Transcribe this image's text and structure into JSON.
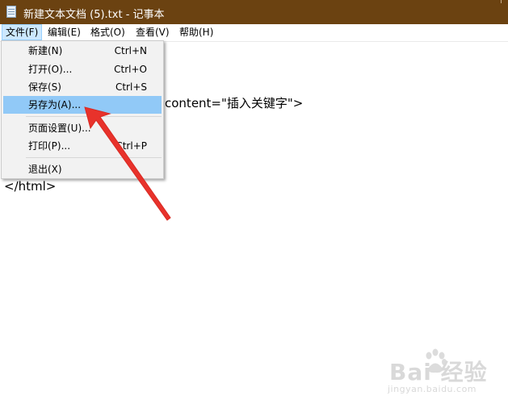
{
  "window": {
    "title": "新建文本文档 (5).txt - 记事本"
  },
  "menubar": {
    "items": [
      {
        "label": "文件(F)"
      },
      {
        "label": "编辑(E)"
      },
      {
        "label": "格式(O)"
      },
      {
        "label": "查看(V)"
      },
      {
        "label": "帮助(H)"
      }
    ],
    "active_index": 0
  },
  "file_menu": {
    "items": [
      {
        "label": "新建(N)",
        "shortcut": "Ctrl+N"
      },
      {
        "label": "打开(O)...",
        "shortcut": "Ctrl+O"
      },
      {
        "label": "保存(S)",
        "shortcut": "Ctrl+S"
      },
      {
        "label": "另存为(A)...",
        "shortcut": ""
      },
      {
        "label": "页面设置(U)...",
        "shortcut": ""
      },
      {
        "label": "打印(P)...",
        "shortcut": "Ctrl+P"
      },
      {
        "label": "退出(X)",
        "shortcut": ""
      }
    ],
    "highlighted": "另存为(A)..."
  },
  "editor": {
    "visible_lines": [
      "content=\"插入关键字\">",
      "</html>"
    ]
  },
  "watermark": {
    "brand": "Bai  经验",
    "url": "jingyan.baidu.com"
  },
  "colors": {
    "titlebar": "#6b4211",
    "menu_highlight": "#91c9f7",
    "annotation_arrow": "#e8322b"
  }
}
